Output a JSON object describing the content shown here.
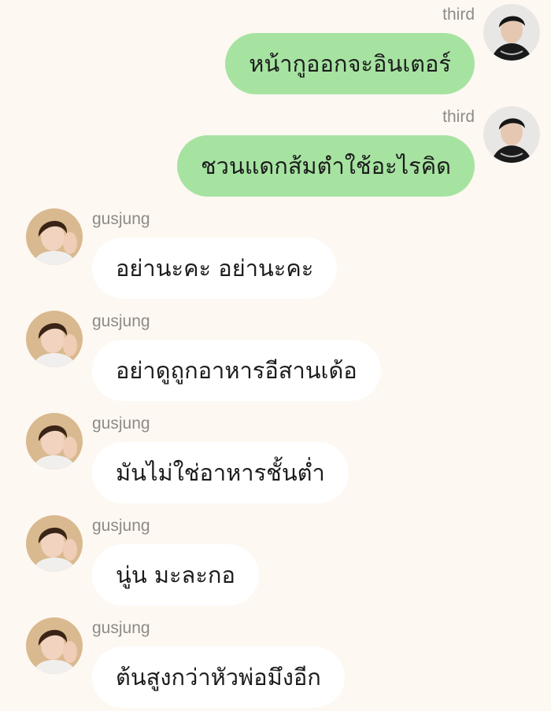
{
  "messages": [
    {
      "sender": "third",
      "side": "out",
      "avatar": "third-avatar",
      "text": "หน้ากูออกจะอินเตอร์"
    },
    {
      "sender": "third",
      "side": "out",
      "avatar": "third-avatar",
      "text": "ชวนแดกส้มตำใช้อะไรคิด"
    },
    {
      "sender": "gusjung",
      "side": "in",
      "avatar": "gusjung-avatar",
      "text": "อย่านะคะ อย่านะคะ"
    },
    {
      "sender": "gusjung",
      "side": "in",
      "avatar": "gusjung-avatar",
      "text": "อย่าดูถูกอาหารอีสานเด้อ"
    },
    {
      "sender": "gusjung",
      "side": "in",
      "avatar": "gusjung-avatar",
      "text": "มันไม่ใช่อาหารชั้นต่ำ"
    },
    {
      "sender": "gusjung",
      "side": "in",
      "avatar": "gusjung-avatar",
      "text": "นู่น มะละกอ"
    },
    {
      "sender": "gusjung",
      "side": "in",
      "avatar": "gusjung-avatar",
      "text": "ต้นสูงกว่าหัวพ่อมึงอีก"
    }
  ],
  "colors": {
    "background": "#fdf8f1",
    "outgoing_bubble": "#a6e3a1",
    "incoming_bubble": "#ffffff",
    "sender_name": "#8e8a86"
  }
}
